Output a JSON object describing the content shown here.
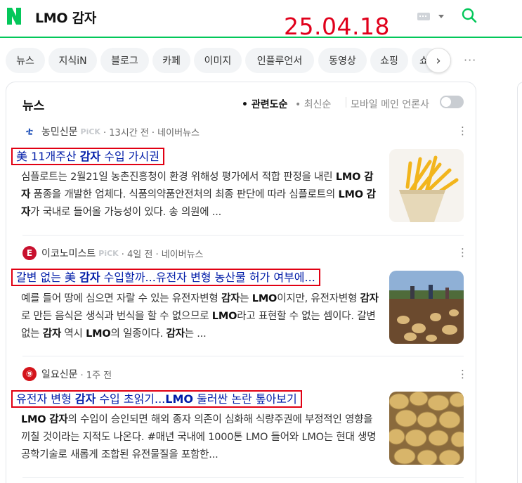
{
  "header": {
    "query": "LMO 감자",
    "stamp_date": "25.04.18"
  },
  "tabs": [
    "뉴스",
    "지식iN",
    "블로그",
    "카페",
    "이미지",
    "인플루언서",
    "동영상",
    "쇼핑",
    "쇼"
  ],
  "section": {
    "title": "뉴스",
    "sort_relevance": "• 관련도순",
    "sort_latest": "• 최신순",
    "mobile_label": "모바일 메인 언론사"
  },
  "articles": [
    {
      "press": "농민신문",
      "pick": "PiCK",
      "meta": "· 13시간 전 · 네이버뉴스",
      "logo_color": "#1d4fb8",
      "headline_html": "美 11개주산 <b>감자</b> 수입 가시권",
      "body_html": "심플로트는 2월21일 농촌진흥청이 환경 위해성 평가에서 적합 판정을 내린 <b>LMO 감자</b> 품종을 개발한 업체다. 식품의약품안전처의 최종 판단에 따라 심플로트의 <b>LMO 감자</b>가 국내로 들어올 가능성이 있다. 송 의원에 ..."
    },
    {
      "press": "이코노미스트",
      "pick": "PiCK",
      "meta": "· 4일 전 · 네이버뉴스",
      "logo_color": "#c8102e",
      "headline_html": "갈변 없는 美 <b>감자</b> 수입할까...유전자 변형 농산물 허가 여부에...",
      "body_html": "예를 들어 땅에 심으면 자랄 수 있는 유전자변형 <b>감자</b>는 <b>LMO</b>이지만, 유전자변형 <b>감자</b>로 만든 음식은 생식과 번식을 할 수 없으므로 <b>LMO</b>라고 표현할 수 없는 셈이다. 갈변없는 <b>감자</b> 역시 <b>LMO</b>의 일종이다. <b>감자</b>는 ..."
    },
    {
      "press": "일요신문",
      "pick": "",
      "meta": "· 1주 전",
      "logo_color": "#d4141b",
      "headline_html": "유전자 변형 <b>감자</b> 수입 초읽기...<b>LMO</b> 둘러싼 논란 톺아보기",
      "body_html": "<b>LMO 감자</b>의 수입이 승인되면 해외 종자 의존이 심화해 식량주권에 부정적인 영향을 끼칠 것이라는 지적도 나온다. #매년 국내에 1000톤 LMO 들어와 LMO는 현대 생명공학기술로 새롭게 조합된 유전물질을 포함한..."
    }
  ],
  "icons": {
    "logo": "naver-n-logo",
    "keyboard": "keyboard-icon",
    "search": "search-icon",
    "more": "more-icon",
    "arrow": "chevron-right-icon"
  },
  "colors": {
    "brand": "#03c75a",
    "headline": "#001ca8",
    "annotation_box": "#e10013"
  }
}
